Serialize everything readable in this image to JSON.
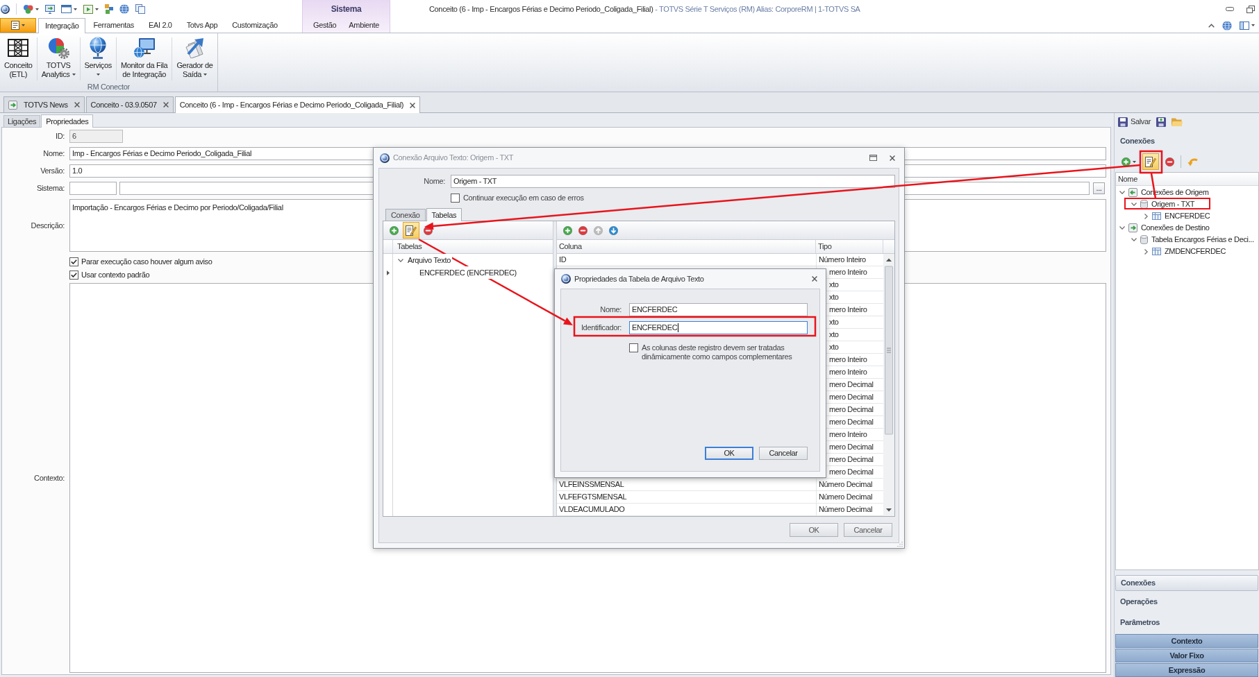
{
  "title_bar": {
    "document": "Conceito (6 - Imp - Encargos Férias e Decimo Periodo_Coligada_Filial)",
    "application": "- TOTVS Série T Serviços (RM) Alias: CorporeRM | 1-TOTVS SA"
  },
  "ribbon_tabs": [
    {
      "label": "Integração",
      "selected": true
    },
    {
      "label": "Ferramentas",
      "selected": false
    },
    {
      "label": "EAI 2.0",
      "selected": false
    },
    {
      "label": "Totvs App",
      "selected": false
    },
    {
      "label": "Customização",
      "selected": false
    }
  ],
  "contextual_group": {
    "label": "Sistema",
    "tabs": [
      {
        "label": "Gestão",
        "selected": false
      },
      {
        "label": "Ambiente",
        "selected": false
      }
    ]
  },
  "ribbon": {
    "groups": [
      {
        "label": "RM Conector",
        "buttons": [
          {
            "lines": [
              "Conceito",
              "(ETL)"
            ],
            "dropdown": false
          },
          {
            "lines": [
              "TOTVS",
              "Analytics"
            ],
            "dropdown": true
          },
          {
            "lines": [
              "Serviços"
            ],
            "dropdown": true
          },
          {
            "lines": [
              "Monitor da Fila",
              "de Integração"
            ],
            "dropdown": false
          },
          {
            "lines": [
              "Gerador de",
              "Saída"
            ],
            "dropdown": true
          }
        ]
      }
    ]
  },
  "document_tabs": [
    {
      "label": "TOTVS News",
      "selected": false
    },
    {
      "label": "Conceito - 03.9.0507",
      "selected": false
    },
    {
      "label": "Conceito (6 - Imp - Encargos Férias e Decimo Periodo_Coligada_Filial)",
      "selected": true
    }
  ],
  "sub_tabs": [
    {
      "label": "Ligações",
      "selected": false
    },
    {
      "label": "Propriedades",
      "selected": true
    }
  ],
  "form": {
    "fields": [
      {
        "kind": "short",
        "label": "ID:",
        "value": "6",
        "disabled": true
      },
      {
        "kind": "text",
        "label": "Nome:",
        "value": "Imp - Encargos Férias e Decimo Periodo_Coligada_Filial",
        "disabled": false
      },
      {
        "kind": "text",
        "label": "Versão:",
        "value": "1.0",
        "disabled": false
      },
      {
        "kind": "lookup",
        "label": "Sistema:",
        "button": "...",
        "disabled": false
      },
      {
        "kind": "memo",
        "label": "Descrição:",
        "value": "Importação - Encargos Férias e Decimo por Periodo/Coligada/Filial",
        "disabled": false
      }
    ],
    "checkboxes": [
      {
        "label": "Parar execução caso houver algum aviso",
        "checked": true
      },
      {
        "label": "Usar contexto padrão",
        "checked": true
      }
    ],
    "context": {
      "label": "Contexto:"
    }
  },
  "connection_dialog": {
    "title": "Conexão Arquivo Texto: Origem - TXT",
    "name_label": "Nome:",
    "name_value": "Origem - TXT",
    "continue_on_error": {
      "label": "Continuar execução em caso de erros",
      "checked": false
    },
    "tabs": [
      {
        "label": "Conexão",
        "selected": false
      },
      {
        "label": "Tabelas",
        "selected": true
      }
    ],
    "tables_toolbar": [
      {
        "kind": "add",
        "highlighted": false
      },
      {
        "kind": "edit",
        "highlighted": true
      },
      {
        "kind": "remove",
        "highlighted": false
      }
    ],
    "tables_header": "Tabelas",
    "tables_tree": [
      {
        "label": "Arquivo Texto",
        "expanded": true,
        "selected": false,
        "children": [
          {
            "label": "ENCFERDEC (ENCFERDEC)",
            "selected": true
          }
        ]
      }
    ],
    "columns_toolbar": [
      {
        "kind": "add",
        "disabled": false
      },
      {
        "kind": "remove",
        "disabled": false
      },
      {
        "kind": "move_up",
        "disabled": true
      },
      {
        "kind": "move_down",
        "disabled": false
      }
    ],
    "column_headers": [
      "Coluna",
      "Tipo"
    ],
    "rows": [
      {
        "column": "ID",
        "type": "Número Inteiro"
      },
      {
        "type": "mero Inteiro"
      },
      {
        "type": "xto"
      },
      {
        "type": "xto"
      },
      {
        "type": "mero Inteiro"
      },
      {
        "type": "xto"
      },
      {
        "type": "xto"
      },
      {
        "type": "xto"
      },
      {
        "type": "mero Inteiro"
      },
      {
        "type": "mero Inteiro"
      },
      {
        "type": "mero Decimal"
      },
      {
        "type": "mero Decimal"
      },
      {
        "type": "mero Decimal"
      },
      {
        "type": "mero Decimal"
      },
      {
        "type": "mero Inteiro"
      },
      {
        "type": "mero Decimal"
      },
      {
        "type": "mero Decimal"
      },
      {
        "type": "mero Decimal"
      },
      {
        "column": "VLFEINSSMENSAL",
        "type": "Número Decimal"
      },
      {
        "column": "VLFEFGTSMENSAL",
        "type": "Número Decimal"
      },
      {
        "column": "VLDEACUMULADO",
        "type": "Número Decimal"
      }
    ],
    "buttons": [
      "OK",
      "Cancelar"
    ]
  },
  "table_dialog": {
    "title": "Propriedades da Tabela de Arquivo Texto",
    "fields": [
      {
        "label": "Nome:",
        "value": "ENCFERDEC",
        "focused": false
      },
      {
        "label": "Identificador:",
        "value": "ENCFERDEC",
        "focused": true
      }
    ],
    "dynamic_columns": {
      "label": "As colunas deste registro devem ser tratadas dinâmicamente como campos complementares",
      "checked": false
    },
    "buttons": [
      {
        "label": "OK",
        "default": true
      },
      {
        "label": "Cancelar",
        "default": false
      }
    ]
  },
  "side_panel": {
    "actions": [
      {
        "kind": "save",
        "label": "Salvar"
      },
      {
        "kind": "save_as"
      },
      {
        "kind": "open"
      }
    ],
    "title": "Conexões",
    "toolbar": [
      {
        "kind": "add",
        "dropdown": true,
        "highlighted": false
      },
      {
        "kind": "edit",
        "dropdown": false,
        "highlighted": true
      },
      {
        "kind": "remove",
        "dropdown": false,
        "highlighted": false
      },
      {
        "kind": "separator"
      },
      {
        "kind": "refresh",
        "dropdown": false,
        "highlighted": false
      }
    ],
    "tree_header": "Nome",
    "tree": [
      {
        "label": "Conexões de Origem",
        "expanded": true,
        "children": [
          {
            "label": "Origem - TXT",
            "expanded": true,
            "children": [
              {
                "label": "ENCFERDEC",
                "expanded": false
              }
            ]
          }
        ]
      },
      {
        "label": "Conexões de Destino",
        "expanded": true,
        "children": [
          {
            "label": "Tabela Encargos Férias e Deci...",
            "expanded": true,
            "children": [
              {
                "label": "ZMDENCFERDEC",
                "expanded": false
              }
            ]
          }
        ]
      }
    ],
    "nav": [
      {
        "label": "Conexões",
        "selected": true
      },
      {
        "label": "Operações",
        "selected": false
      },
      {
        "label": "Parâmetros",
        "selected": false
      }
    ],
    "buttons": [
      "Contexto",
      "Valor Fixo",
      "Expressão"
    ]
  }
}
